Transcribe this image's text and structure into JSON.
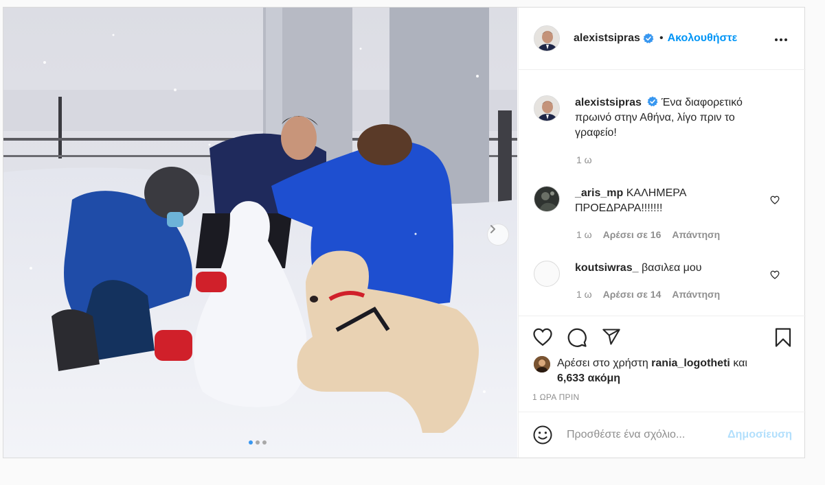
{
  "post": {
    "author": "alexistsipras",
    "follow_label": "Ακολουθήστε",
    "separator": "•",
    "caption": "Ένα διαφορετικό πρωινό στην Αθήνα, λίγο πριν το γραφείο!",
    "caption_age": "1 ω",
    "comments": [
      {
        "user": "_aris_mp",
        "text": "ΚΑΛΗΜΕΡΑ ΠΡΟΕΔΡΑΡΑ!!!!!!!",
        "age": "1 ω",
        "likes": "Αρέσει σε 16",
        "reply": "Απάντηση"
      },
      {
        "user": "koutsiwras_",
        "text": "βασιλεα μου",
        "age": "1 ω",
        "likes": "Αρέσει σε 14",
        "reply": "Απάντηση"
      }
    ],
    "likes_prefix": "Αρέσει στο χρήστη",
    "likes_user": "rania_logotheti",
    "likes_and": "και",
    "likes_count": "6,633 ακόμη",
    "time": "1 ΩΡΑ ΠΡΙΝ",
    "comment_placeholder": "Προσθέστε ένα σχόλιο...",
    "publish_label": "Δημοσίευση",
    "carousel": {
      "total": 3,
      "active": 1
    },
    "icons": {
      "verified": "verified-badge-icon",
      "more": "more-options-icon",
      "like": "heart-icon",
      "comment": "comment-icon",
      "share": "share-icon",
      "save": "bookmark-icon",
      "emoji": "emoji-icon",
      "next": "chevron-right-icon"
    },
    "colors": {
      "accent": "#0095f6",
      "verified": "#3897f0",
      "publish_disabled": "#b2dffc"
    }
  }
}
